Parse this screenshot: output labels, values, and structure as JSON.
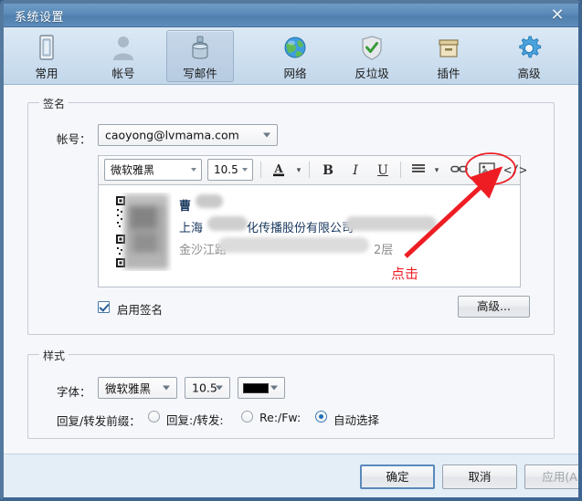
{
  "window": {
    "title": "系统设置",
    "close_icon": "close-icon",
    "accent": "#5b8ab8",
    "body_bg": "#f5f7fb"
  },
  "tabs": [
    {
      "label": "常用",
      "icon": "battery-icon",
      "active": false
    },
    {
      "label": "帐号",
      "icon": "user-icon",
      "active": false
    },
    {
      "label": "写邮件",
      "icon": "inkwell-icon",
      "active": true
    },
    {
      "label": "网络",
      "icon": "globe-icon",
      "active": false
    },
    {
      "label": "反垃圾",
      "icon": "shield-check-icon",
      "active": false
    },
    {
      "label": "插件",
      "icon": "plugin-box-icon",
      "active": false
    },
    {
      "label": "高级",
      "icon": "gear-icon",
      "active": false
    }
  ],
  "signature_group": {
    "title": "签名",
    "account_label": "帐号：",
    "account_value": "caoyong@lvmama.com",
    "enable_checkbox_label": "启用签名",
    "enable_checked": true,
    "advanced_button": "高级..."
  },
  "editor_toolbar": {
    "font_family": "微软雅黑",
    "font_size": "10.5",
    "buttons": [
      {
        "name": "font-color-icon",
        "glyph": "A"
      },
      {
        "name": "color-dropdown-arrow-icon",
        "glyph": "▾"
      },
      {
        "name": "bold-icon",
        "glyph": "B"
      },
      {
        "name": "italic-icon",
        "glyph": "I"
      },
      {
        "name": "underline-icon",
        "glyph": "U"
      },
      {
        "name": "align-icon",
        "glyph": "≡"
      },
      {
        "name": "align-dropdown-arrow-icon",
        "glyph": "▾"
      },
      {
        "name": "link-icon",
        "glyph": "🔗"
      },
      {
        "name": "image-icon",
        "glyph": "🖼"
      },
      {
        "name": "source-code-icon",
        "glyph": "</>"
      }
    ]
  },
  "signature_body": {
    "name_line": "曹",
    "company_line_prefix": "上海",
    "company_line_suffix": "化传播股份有限公司",
    "address_line_prefix": "金沙江路",
    "address_line_suffix": "2层",
    "qr_code": "qr-code-image"
  },
  "style_group": {
    "title": "样式",
    "font_label": "字体：",
    "font_family": "微软雅黑",
    "font_size": "10.5",
    "font_color": "#000000",
    "prefix_label": "回复/转发前缀：",
    "prefix_options": [
      {
        "label": "回复:/转发:",
        "selected": false
      },
      {
        "label": "Re:/Fw:",
        "selected": false
      },
      {
        "label": "自动选择",
        "selected": true
      }
    ]
  },
  "footer": {
    "ok": "确定",
    "cancel": "取消",
    "apply": "应用(A)",
    "apply_disabled": true
  },
  "annotation": {
    "text": "点击",
    "color": "#ee1d24",
    "target": "source-code-icon"
  }
}
